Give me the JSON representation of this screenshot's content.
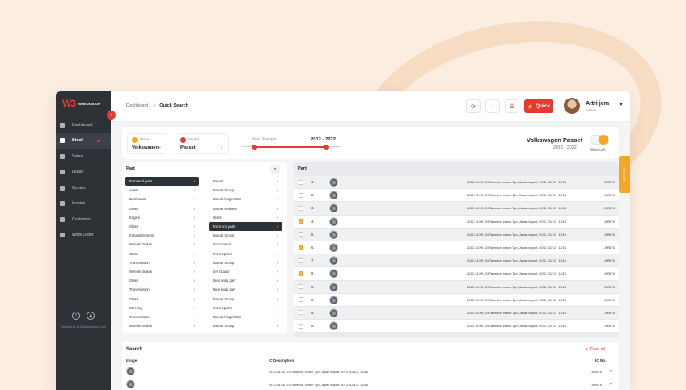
{
  "brand": {
    "mark": "W3",
    "name": "WRECKBOOK"
  },
  "sidebar": {
    "items": [
      {
        "label": "Dashboard",
        "icon": "grid-icon",
        "active": false
      },
      {
        "label": "Stock",
        "icon": "refresh-icon",
        "active": true
      },
      {
        "label": "Sales",
        "icon": "tag-icon",
        "active": false
      },
      {
        "label": "Leads",
        "icon": "chart-icon",
        "active": false
      },
      {
        "label": "Quotes",
        "icon": "quote-icon",
        "active": false
      },
      {
        "label": "Invoice",
        "icon": "invoice-icon",
        "active": false
      },
      {
        "label": "Customer",
        "icon": "user-icon",
        "active": false
      },
      {
        "label": "Work Order",
        "icon": "clipboard-icon",
        "active": false
      }
    ],
    "footer": {
      "powered": "Powered by DLD Management LLC"
    }
  },
  "header": {
    "breadcrumb": {
      "parent": "Dashboard",
      "current": "Quick Search"
    },
    "quick_label": "Quick",
    "user": {
      "name": "Attri jem",
      "role": "Admin"
    }
  },
  "filters": {
    "make": {
      "label": "Make",
      "value": "Volkswagen"
    },
    "model": {
      "label": "Model",
      "value": "Passet"
    },
    "year_range_label": "Year Range",
    "year_range_value": "2012 - 2022",
    "year_range": {
      "min": 2012,
      "max": 2022
    },
    "vehicle_title": "Volkswagen Passet",
    "vehicle_years": "2012 - 2022",
    "network_label": "Network",
    "network_on": true
  },
  "side_tab": "Show Cart",
  "part_panel": {
    "title": "Part",
    "left_column": [
      "Front end parts",
      "Axles",
      "Dashboard",
      "Glass",
      "Engine",
      "Glass",
      "Exhaust System",
      "Wheels Brakes",
      "Glass",
      "Transmission",
      "Wheels Brakes",
      "Glass",
      "Transmission",
      "Glass",
      "Steering",
      "Transmission",
      "Wheels Brakes"
    ],
    "right_column": [
      "Bonnet",
      "Bonnet Scoop",
      "Bonnet hinge/Strut",
      "Bonnet Release",
      "Glass",
      "Front end parts",
      "Bonnet Scoop",
      "Front Panel",
      "Front Spoiler",
      "Bonnet Scoop",
      "Left Guard",
      "Rear body part",
      "Rear body part",
      "Bonnet Scoop",
      "Front Spoiler",
      "Bonnet hinge/Strut",
      "Bonnet Scoop"
    ]
  },
  "results": {
    "title": "Part",
    "rows": [
      {
        "num": "1.",
        "desc": "2012-14 KE, Gt/Tanmkor, xenon Tyo, Japan import, k072, 02/12 - 12/14",
        "ic": "J97876",
        "checked": false
      },
      {
        "num": "2.",
        "desc": "2012-14 KE, Gt/Tanmkor, xenon Tyo, Japan import, k072, 02/12 - 12/14",
        "ic": "J97876",
        "checked": false
      },
      {
        "num": "3.",
        "desc": "2012-14 KE, Gt/Tanmkor, xenon Tyo, Japan import, k072, 02/12 - 12/14",
        "ic": "J97876",
        "checked": false
      },
      {
        "num": "4.",
        "desc": "2012-14 KE, Gt/Tanmkor, xenon Tyo, Japan import, k072, 02/12 - 12/14",
        "ic": "J97876",
        "checked": true
      },
      {
        "num": "5.",
        "desc": "2012-14 KE, Gt/Tanmkor, xenon Tyo, Japan import, k072, 02/12 - 12/14",
        "ic": "J97876",
        "checked": false
      },
      {
        "num": "6.",
        "desc": "2012-14 KE, Gt/Tanmkor, xenon Tyo, Japan import, k072, 02/12 - 12/14",
        "ic": "J97876",
        "checked": true
      },
      {
        "num": "7.",
        "desc": "2012-14 KE, Gt/Tanmkor, xenon Tyo, Japan import, k072, 02/12 - 12/14",
        "ic": "J97876",
        "checked": false
      },
      {
        "num": "8.",
        "desc": "2012-14 KE, Gt/Tanmkor, xenon Tyo, Japan import, k072, 02/12 - 12/14",
        "ic": "J97876",
        "checked": true
      },
      {
        "num": "9.",
        "desc": "2012-14 KE, Gt/Tanmkor, xenon Tyo, Japan import, k072, 02/12 - 12/14",
        "ic": "J97876",
        "checked": false
      },
      {
        "num": "9.",
        "desc": "2012-14 KE, Gt/Tanmkor, xenon Tyo, Japan import, k072, 02/12 - 12/14",
        "ic": "J97876",
        "checked": false
      },
      {
        "num": "9.",
        "desc": "2012-14 KE, Gt/Tanmkor, xenon Tyo, Japan import, k072, 02/12 - 12/14",
        "ic": "J97876",
        "checked": false
      },
      {
        "num": "9.",
        "desc": "2012-14 KE, Gt/Tanmkor, xenon Tyo, Japan import, k072, 02/12 - 12/14",
        "ic": "J97876",
        "checked": false
      }
    ]
  },
  "search": {
    "title": "Search",
    "clear_label": "Clear all",
    "headers": {
      "image": "Image",
      "desc": "IC Description",
      "ic": "IC No."
    },
    "rows": [
      {
        "desc": "2012-14 KE, Gt/Tanmkor, xenon Tyo, Japan import, k072, 02/12 - 12/14",
        "ic": "J97876"
      },
      {
        "desc": "2012-14 KE, Gt/Tanmkor, xenon Tyo, Japan import, k072, 02/12 - 12/14",
        "ic": "J97876"
      }
    ]
  },
  "colors": {
    "accent": "#e53935",
    "highlight": "#f5a623",
    "sidebar": "#2c3236"
  }
}
